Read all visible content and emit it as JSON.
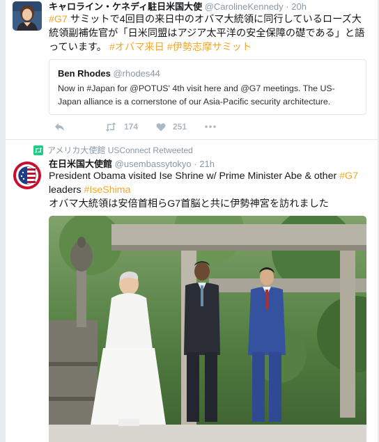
{
  "tweet1": {
    "name": "キャロライン・ケネディ駐日米国大使",
    "handle": "@CarolineKennedy",
    "dot": "·",
    "time": "20h",
    "text_hashtag_1": "#G7",
    "text_1": " サミットで4回目の来日中のオバマ大統領に同行しているローズ大統領副補佐官が「日米同盟はアジア太平洋の安全保障の礎である」と語っています。",
    "text_hashtag_2": "#オバマ来日",
    "text_hashtag_3": "#伊勢志摩サミット",
    "quote": {
      "name": "Ben Rhodes",
      "handle": "@rhodes44",
      "text": "Now in #Japan for @POTUS' 4th visit here and @G7 meetings. The US-Japan alliance is a cornerstone of our Asia-Pacific security architecture."
    },
    "actions": {
      "reply_icon": "reply-icon",
      "retweet_icon": "retweet-icon",
      "retweet_count": "174",
      "like_icon": "heart-icon",
      "like_count": "251",
      "more_icon": "more-icon"
    }
  },
  "tweet2": {
    "retweet_context": "アメリカ大使館 USConnect Retweeted",
    "name": "在日米国大使館",
    "handle": "@usembassytokyo",
    "dot": "·",
    "time": "21h",
    "text_1": "President Obama visited Ise Shrine w/ Prime Minister Abe & other ",
    "text_hashtag_1": "#G7",
    "text_2": "leaders ",
    "text_hashtag_2": "#IseShima",
    "text_3": "オバマ大統領は安倍首相らG7首脳と共に伊勢神宮を訪れました"
  },
  "colors": {
    "hashtag": "#f5a623",
    "muted": "#8899a6",
    "icon": "#aab8c2",
    "border": "#e1e8ed",
    "background": "#e6ecf0"
  }
}
